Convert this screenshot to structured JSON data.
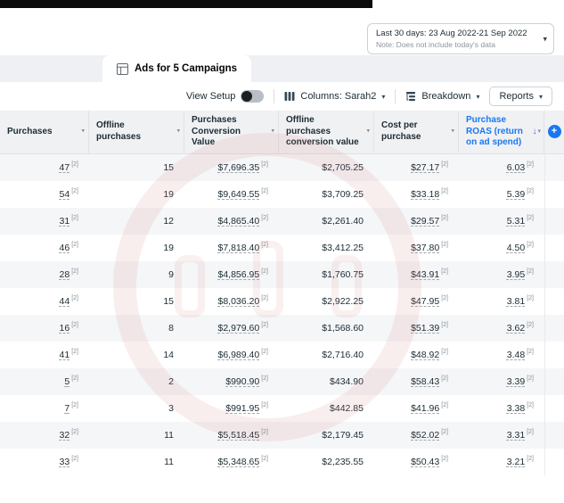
{
  "colors": {
    "accent_blue": "#1877F2",
    "header_bg": "#F0F1F3",
    "row_alt_bg": "#F5F6F8",
    "text_primary": "#1C2B33",
    "text_secondary": "#8A8D91",
    "watermark_pink": "#CD7878"
  },
  "icons": {
    "caret_down": "▾",
    "sort_desc_arrow": "↓",
    "plus": "+"
  },
  "date_filter": {
    "label": "Last 30 days: 23 Aug 2022-21 Sep 2022",
    "note": "Note: Does not include today's data"
  },
  "tab": {
    "label": "Ads for 5 Campaigns"
  },
  "toolbar": {
    "view_setup_label": "View Setup",
    "columns_label": "Columns: Sarah2",
    "breakdown_label": "Breakdown",
    "reports_label": "Reports"
  },
  "table": {
    "superscript": "[2]",
    "columns": [
      {
        "label": "Purchases"
      },
      {
        "label": "Offline purchases"
      },
      {
        "label": "Purchases Conversion Value"
      },
      {
        "label": "Offline purchases conversion value"
      },
      {
        "label": "Cost per purchase"
      },
      {
        "label": "Purchase ROAS (return on ad spend)",
        "sorted": "desc"
      }
    ],
    "rows": [
      {
        "purchases": "47",
        "offline_purchases": "15",
        "purchases_conversion_value": "$7,696.35",
        "offline_purchases_conversion_value": "$2,705.25",
        "cost_per_purchase": "$27.17",
        "purchase_roas": "6.03"
      },
      {
        "purchases": "54",
        "offline_purchases": "19",
        "purchases_conversion_value": "$9,649.55",
        "offline_purchases_conversion_value": "$3,709.25",
        "cost_per_purchase": "$33.18",
        "purchase_roas": "5.39"
      },
      {
        "purchases": "31",
        "offline_purchases": "12",
        "purchases_conversion_value": "$4,865.40",
        "offline_purchases_conversion_value": "$2,261.40",
        "cost_per_purchase": "$29.57",
        "purchase_roas": "5.31"
      },
      {
        "purchases": "46",
        "offline_purchases": "19",
        "purchases_conversion_value": "$7,818.40",
        "offline_purchases_conversion_value": "$3,412.25",
        "cost_per_purchase": "$37.80",
        "purchase_roas": "4.50"
      },
      {
        "purchases": "28",
        "offline_purchases": "9",
        "purchases_conversion_value": "$4,856.95",
        "offline_purchases_conversion_value": "$1,760.75",
        "cost_per_purchase": "$43.91",
        "purchase_roas": "3.95"
      },
      {
        "purchases": "44",
        "offline_purchases": "15",
        "purchases_conversion_value": "$8,036.20",
        "offline_purchases_conversion_value": "$2,922.25",
        "cost_per_purchase": "$47.95",
        "purchase_roas": "3.81"
      },
      {
        "purchases": "16",
        "offline_purchases": "8",
        "purchases_conversion_value": "$2,979.60",
        "offline_purchases_conversion_value": "$1,568.60",
        "cost_per_purchase": "$51.39",
        "purchase_roas": "3.62"
      },
      {
        "purchases": "41",
        "offline_purchases": "14",
        "purchases_conversion_value": "$6,989.40",
        "offline_purchases_conversion_value": "$2,716.40",
        "cost_per_purchase": "$48.92",
        "purchase_roas": "3.48"
      },
      {
        "purchases": "5",
        "offline_purchases": "2",
        "purchases_conversion_value": "$990.90",
        "offline_purchases_conversion_value": "$434.90",
        "cost_per_purchase": "$58.43",
        "purchase_roas": "3.39"
      },
      {
        "purchases": "7",
        "offline_purchases": "3",
        "purchases_conversion_value": "$991.95",
        "offline_purchases_conversion_value": "$442.85",
        "cost_per_purchase": "$41.96",
        "purchase_roas": "3.38"
      },
      {
        "purchases": "32",
        "offline_purchases": "11",
        "purchases_conversion_value": "$5,518.45",
        "offline_purchases_conversion_value": "$2,179.45",
        "cost_per_purchase": "$52.02",
        "purchase_roas": "3.31"
      },
      {
        "purchases": "33",
        "offline_purchases": "11",
        "purchases_conversion_value": "$5,348.65",
        "offline_purchases_conversion_value": "$2,235.55",
        "cost_per_purchase": "$50.43",
        "purchase_roas": "3.21"
      }
    ]
  }
}
